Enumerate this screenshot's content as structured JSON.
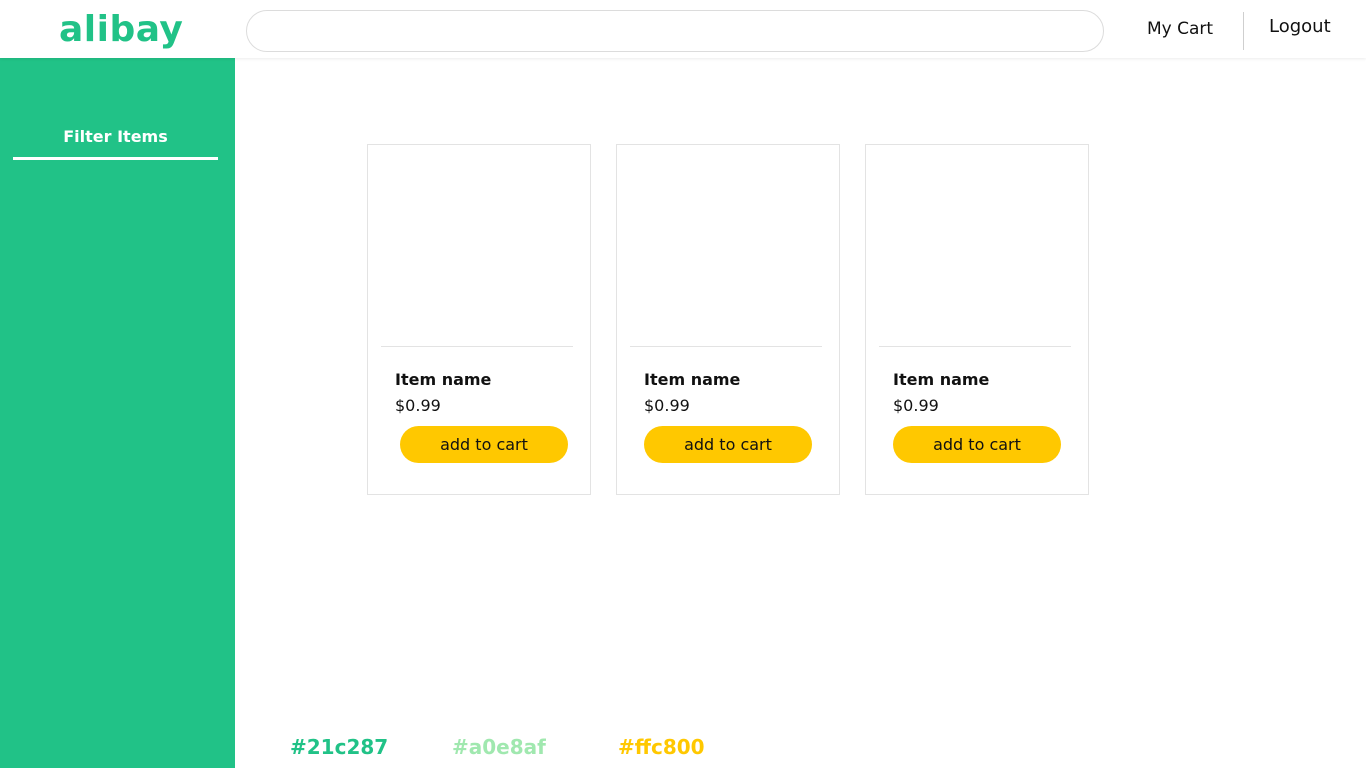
{
  "header": {
    "logo": "alibay",
    "search": {
      "value": "",
      "placeholder": ""
    },
    "my_cart": "My Cart",
    "logout": "Logout"
  },
  "sidebar": {
    "title": "Filter Items"
  },
  "products": [
    {
      "name": "Item name",
      "price": "$0.99",
      "button": "add to cart"
    },
    {
      "name": "Item name",
      "price": "$0.99",
      "button": "add to cart"
    },
    {
      "name": "Item name",
      "price": "$0.99",
      "button": "add to cart"
    }
  ],
  "palette": [
    {
      "label": "#21c287",
      "color": "#21c287"
    },
    {
      "label": "#a0e8af",
      "color": "#a0e8af"
    },
    {
      "label": "#ffc800",
      "color": "#ffc800"
    }
  ],
  "colors": {
    "brand": "#21c287",
    "accent": "#ffc800",
    "light": "#a0e8af"
  }
}
